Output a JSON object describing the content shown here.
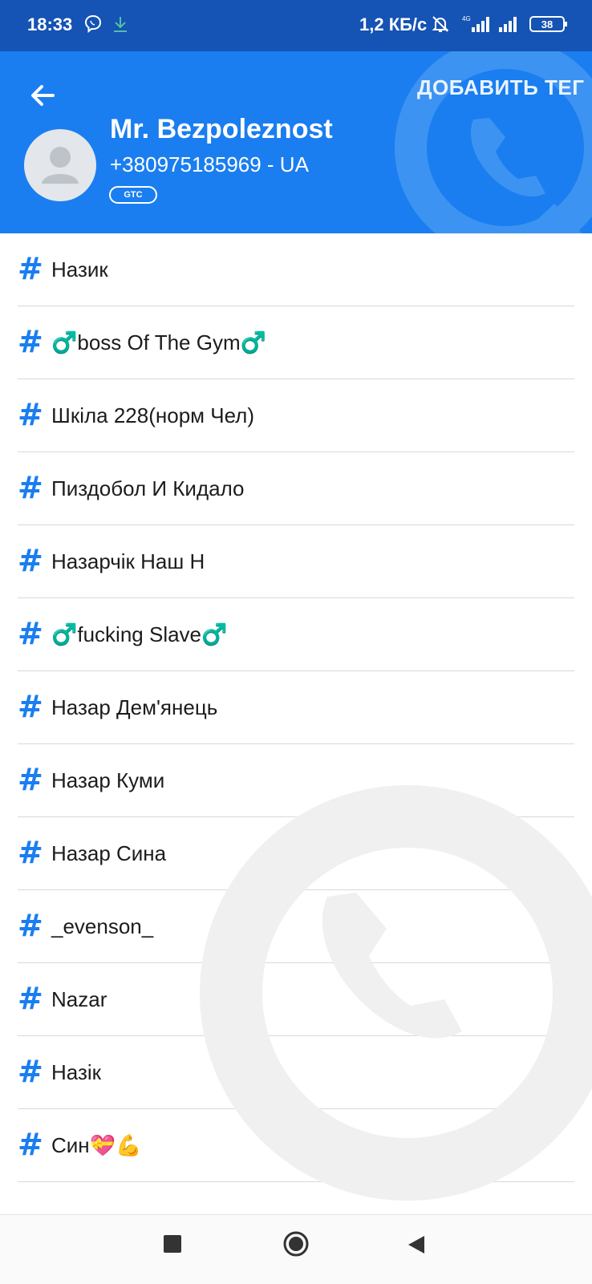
{
  "status_bar": {
    "time": "18:33",
    "network_speed": "1,2 КБ/с",
    "battery": "38",
    "network_type": "4G"
  },
  "header": {
    "add_tag_label": "ДОБАВИТЬ ТЕГ",
    "contact_name": "Mr. Bezpoleznost",
    "phone": "+380975185969 - UA",
    "carrier_badge": "GTC",
    "accent_color": "#1a7ef0",
    "status_bar_color": "#1553b4"
  },
  "tags": [
    {
      "label": "Назик"
    },
    {
      "label": "♂️boss Of The Gym♂️"
    },
    {
      "label": "Шкіла 228(норм Чел)"
    },
    {
      "label": "Пиздобол И Кидало"
    },
    {
      "label": "Назарчік Наш Н"
    },
    {
      "label": "♂️fucking Slave♂️"
    },
    {
      "label": "Назар Дем'янець"
    },
    {
      "label": "Назар Куми"
    },
    {
      "label": "Назар Сина"
    },
    {
      "label": "_evenson_"
    },
    {
      "label": "Nazar"
    },
    {
      "label": "Назік"
    },
    {
      "label": "Син💝💪"
    }
  ],
  "icons": {
    "back": "arrow-left-icon",
    "hash": "hash-icon",
    "nav_recent": "square-icon",
    "nav_home": "circle-icon",
    "nav_back": "triangle-back-icon"
  }
}
